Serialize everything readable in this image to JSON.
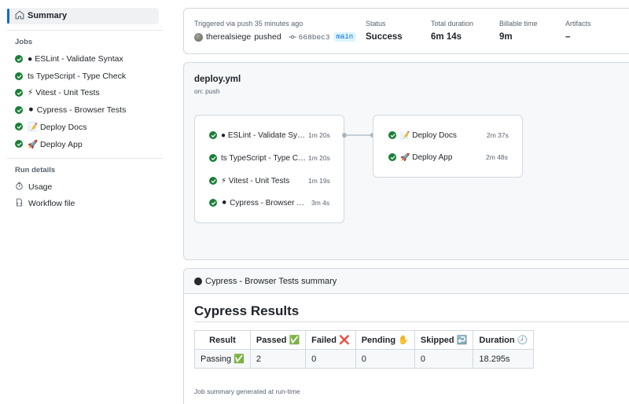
{
  "sidebar": {
    "summary_label": "Summary",
    "jobs_heading": "Jobs",
    "jobs": [
      {
        "icon": "●",
        "name": "ESLint - Validate Syntax"
      },
      {
        "icon": "ts",
        "name": "TypeScript - Type Check"
      },
      {
        "icon": "⚡",
        "name": "Vitest - Unit Tests"
      },
      {
        "icon": "⚫",
        "name": "Cypress - Browser Tests"
      },
      {
        "icon": "📝",
        "name": "Deploy Docs"
      },
      {
        "icon": "🚀",
        "name": "Deploy App"
      }
    ],
    "run_details_heading": "Run details",
    "run_details": [
      {
        "icon": "stopwatch-icon",
        "label": "Usage"
      },
      {
        "icon": "file-icon",
        "label": "Workflow file"
      }
    ]
  },
  "summary": {
    "trigger_text": "Triggered via push 35 minutes ago",
    "user": "therealsiege",
    "action": "pushed",
    "commit": "668bec3",
    "branch": "main",
    "status_label": "Status",
    "status_value": "Success",
    "duration_label": "Total duration",
    "duration_value": "6m 14s",
    "billable_label": "Billable time",
    "billable_value": "9m",
    "artifacts_label": "Artifacts",
    "artifacts_value": "–"
  },
  "workflow": {
    "file": "deploy.yml",
    "trigger": "on: push",
    "stage1": [
      {
        "label": "● ESLint - Validate Syn…",
        "duration": "1m 20s"
      },
      {
        "label": "ts TypeScript - Type C…",
        "duration": "1m 20s"
      },
      {
        "label": "⚡ Vitest - Unit Tests",
        "duration": "1m 19s"
      },
      {
        "label": "⚫ Cypress - Browser T…",
        "duration": "3m 4s"
      }
    ],
    "stage2": [
      {
        "label": "📝 Deploy Docs",
        "duration": "2m 37s"
      },
      {
        "label": "🚀 Deploy App",
        "duration": "2m 48s"
      }
    ]
  },
  "cypress": {
    "header": "Cypress - Browser Tests summary",
    "title": "Cypress Results",
    "columns": [
      "Result",
      "Passed ✅",
      "Failed ❌",
      "Pending ✋",
      "Skipped ↩️",
      "Duration 🕗"
    ],
    "row": [
      "Passing ✅",
      "2",
      "0",
      "0",
      "0",
      "18.295s"
    ],
    "footer": "Job summary generated at run-time"
  },
  "colors": {
    "success": "#1a7f37",
    "accent": "#0969da",
    "border": "#d1d9e0"
  }
}
